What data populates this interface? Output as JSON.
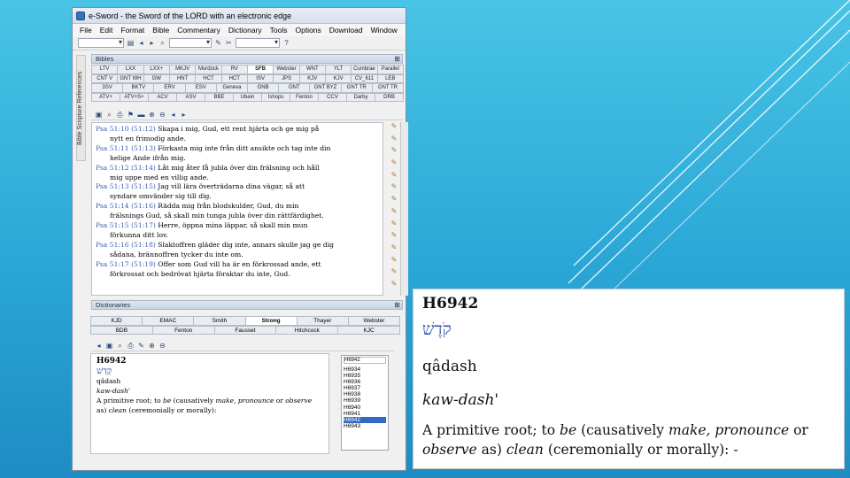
{
  "window": {
    "title": "e-Sword - the Sword of the LORD with an electronic edge",
    "menus": [
      "File",
      "Edit",
      "Format",
      "Bible",
      "Commentary",
      "Dictionary",
      "Tools",
      "Options",
      "Download",
      "Window"
    ]
  },
  "side_tab_label": "Bible Scripture References",
  "bibles": {
    "panel_title": "Bibles",
    "tab_rows": [
      [
        "LTV",
        "LXX",
        "LXX+",
        "MKJV",
        "Murdock",
        "RV",
        "SFB",
        "Webster",
        "WNT",
        "YLT",
        "Cumbrae",
        "Parallel"
      ],
      [
        "CNT V",
        "GNT WH",
        "GW",
        "HNT",
        "HCT",
        "HCT",
        "ISV",
        "JPS",
        "KJV",
        "KJV",
        "CV_611",
        "LEB"
      ],
      [
        "3SV",
        "BKTV",
        "ERV",
        "ESV",
        "Geneva",
        "GNB",
        "GNT",
        "GNT BYZ",
        "GNT TR",
        "GNT TR"
      ],
      [
        "ATV+",
        "ATV+S+",
        "ACV",
        "ASV",
        "BBE",
        "Ubein",
        "Ishops",
        "Fenton",
        "CCV",
        "Darby",
        "DRB"
      ]
    ],
    "active_tab": "SFB",
    "verses": [
      {
        "ref": "Psa 51:10",
        "num": "(51:12)",
        "first": "Skapa i mig, Gud, ett rent hjärta och ge mig på",
        "rest": "nytt en frimodig ande."
      },
      {
        "ref": "Psa 51:11",
        "num": "(51:13)",
        "first": "Förkasta mig inte från ditt ansikte och tag inte din",
        "rest": "helige Ande ifrån mig."
      },
      {
        "ref": "Psa 51:12",
        "num": "(51:14)",
        "first": "Låt mig åter få jubla över din frälsning och håll",
        "rest": "mig uppe med en villig ande."
      },
      {
        "ref": "Psa 51:13",
        "num": "(51:15)",
        "first": "Jag vill lära överträdarna dina vägar, så att",
        "rest": "syndare omvänder sig till dig."
      },
      {
        "ref": "Psa 51:14",
        "num": "(51:16)",
        "first": "Rädda mig från blodskulder, Gud, du min",
        "rest": "frälsnings Gud, så skall min tunga jubla över din rättfärdighet."
      },
      {
        "ref": "Psa 51:15",
        "num": "(51:17)",
        "first": "Herre, öppna mina läppar, så skall min mun",
        "rest": "förkunna ditt lov."
      },
      {
        "ref": "Psa 51:16",
        "num": "(51:18)",
        "first": "Slaktoffren gläder dig inte, annars skulle jag ge dig",
        "rest": "sådana, brännoffren tycker du inte om."
      },
      {
        "ref": "Psa 51:17",
        "num": "(51:19)",
        "first": "Offer som Gud vill ha är en förkrossad ande, ett",
        "rest": "förkrossat och bedrövat hjärta föraktar du inte, Gud."
      }
    ]
  },
  "dictionaries": {
    "panel_title": "Dictionaries",
    "tab_rows": [
      [
        "KJD",
        "EMAC",
        "Smith",
        "Strong",
        "Thayer",
        "Webster"
      ],
      [
        "BDB",
        "Fenton",
        "Fausset",
        "Hitchcock",
        "KJC"
      ]
    ],
    "active_tab": "Strong",
    "entry": {
      "head": "H6942",
      "hebrew": "קָדַשׁ",
      "translit": "qâdash",
      "pronunciation": "kaw-dash'",
      "def_parts": [
        {
          "t": "A primitive root; to ",
          "i": false
        },
        {
          "t": "be",
          "i": true
        },
        {
          "t": " (causatively ",
          "i": false
        },
        {
          "t": "make, pronounce",
          "i": true
        },
        {
          "t": " or ",
          "i": false
        },
        {
          "t": "observe",
          "i": true
        },
        {
          "t": " as) ",
          "i": false
        },
        {
          "t": "clean",
          "i": true
        },
        {
          "t": " (ceremonially or morally):",
          "i": false
        }
      ]
    },
    "search_value": "H6942",
    "list": [
      "H6934",
      "H6935",
      "H6936",
      "H6937",
      "H6938",
      "H6939",
      "H6940",
      "H6941",
      "H6942",
      "H6943"
    ],
    "selected": "H6942"
  },
  "zoom": {
    "head": "H6942",
    "hebrew": "קֹדֶשׁ",
    "translit": "qâdash",
    "pronunciation": "kaw-dash'",
    "def_parts": [
      {
        "t": "A primitive root; to ",
        "i": false
      },
      {
        "t": "be",
        "i": true
      },
      {
        "t": " (causatively ",
        "i": false
      },
      {
        "t": "make, pronounce",
        "i": true
      },
      {
        "t": " or ",
        "i": false
      },
      {
        "t": "observe",
        "i": true
      },
      {
        "t": " as) ",
        "i": false
      },
      {
        "t": "clean",
        "i": true
      },
      {
        "t": " (ceremonially or morally): -",
        "i": false
      }
    ]
  },
  "colors": {
    "slide_bg_top": "#49c4e6",
    "slide_bg_bottom": "#1e8cc3",
    "verse_ref": "#3a5fb0",
    "hebrew": "#3555b5",
    "selection": "#316ac5"
  }
}
